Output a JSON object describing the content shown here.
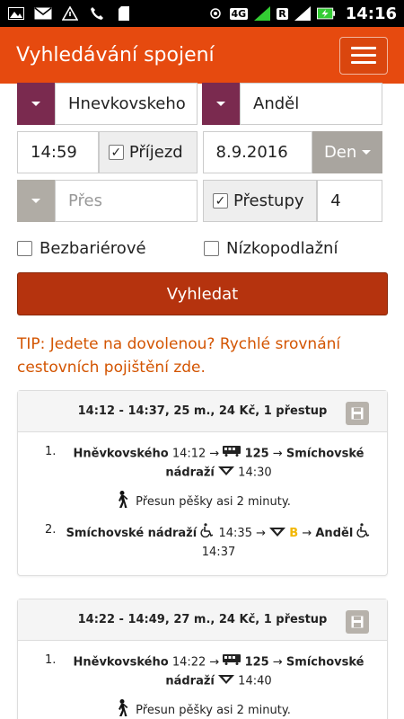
{
  "status_bar": {
    "time": "14:16",
    "network": "4G",
    "roaming": "R",
    "sim2": "2"
  },
  "app": {
    "title": "Vyhledávání spojení"
  },
  "form": {
    "from": "Hnevkovskeho",
    "to": "Anděl",
    "time": "14:59",
    "arrival_label": "Příjezd",
    "date": "8.9.2016",
    "day_button": "Den",
    "via_placeholder": "Přes",
    "transfers_label": "Přestupy",
    "transfers_value": "4",
    "barrier_free_label": "Bezbariérové",
    "low_floor_label": "Nízkopodlažní",
    "search_button": "Vyhledat"
  },
  "tip": "TIP: Jedete na dovolenou? Rychlé srovnání cestovních pojištění zde.",
  "results": [
    {
      "summary": "14:12 - 14:37, 25 m., 24 Kč, 1 přestup",
      "legs": [
        {
          "num": "1.",
          "from": "Hněvkovského",
          "dep": "14:12",
          "line": "125",
          "to": "Smíchovské nádraží",
          "arr": "14:30"
        },
        {
          "num": "2.",
          "from": "Smíchovské nádraží",
          "dep": "14:35",
          "line": "B",
          "to": "Anděl",
          "arr": "14:37"
        }
      ],
      "walk": "Přesun pěšky asi 2 minuty."
    },
    {
      "summary": "14:22 - 14:49, 27 m., 24 Kč, 1 přestup",
      "legs": [
        {
          "num": "1.",
          "from": "Hněvkovského",
          "dep": "14:22",
          "line": "125",
          "to": "Smíchovské nádraží",
          "arr": "14:40"
        }
      ],
      "walk": "Přesun pěšky asi 2 minuty."
    }
  ]
}
